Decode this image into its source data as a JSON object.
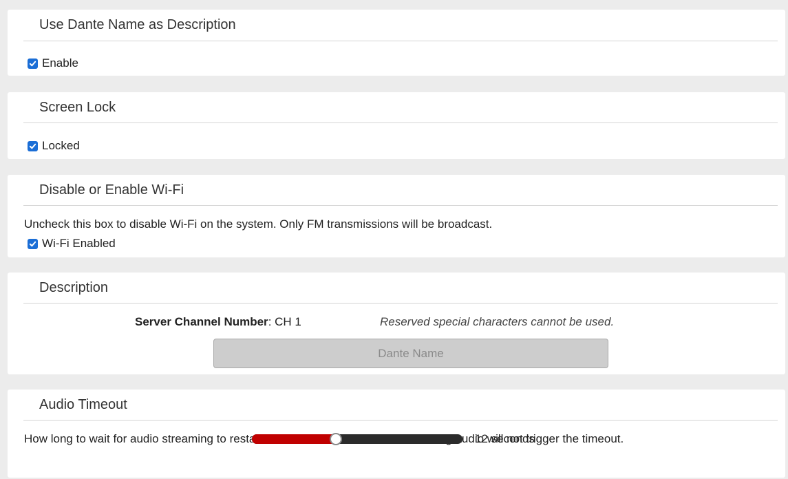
{
  "sections": {
    "dante_description": {
      "title": "Use Dante Name as Description",
      "checkbox_label": "Enable",
      "checked": true
    },
    "screen_lock": {
      "title": "Screen Lock",
      "checkbox_label": "Locked",
      "checked": true
    },
    "wifi": {
      "title": "Disable or Enable Wi-Fi",
      "help_text": "Uncheck this box to disable Wi-Fi on the system. Only FM transmissions will be broadcast.",
      "checkbox_label": "Wi-Fi Enabled",
      "checked": true
    },
    "description": {
      "title": "Description",
      "channel_label": "Server Channel Number",
      "channel_value": ": CH 1",
      "reserved_note": "Reserved special characters cannot be used.",
      "name_placeholder": "Dante Name"
    },
    "audio_timeout": {
      "title": "Audio Timeout",
      "help_text": "How long to wait for audio streaming to restart after disconnected. Silent streaming audio will not trigger the timeout.",
      "slider_fraction": 0.4,
      "value_label": "12 seconds"
    }
  },
  "colors": {
    "checkbox": "#1b6ed6",
    "slider_fill": "#c00000",
    "slider_track": "#2b2b2b",
    "page_background": "#ececec"
  },
  "icons": {
    "checkmark": "check-icon"
  }
}
